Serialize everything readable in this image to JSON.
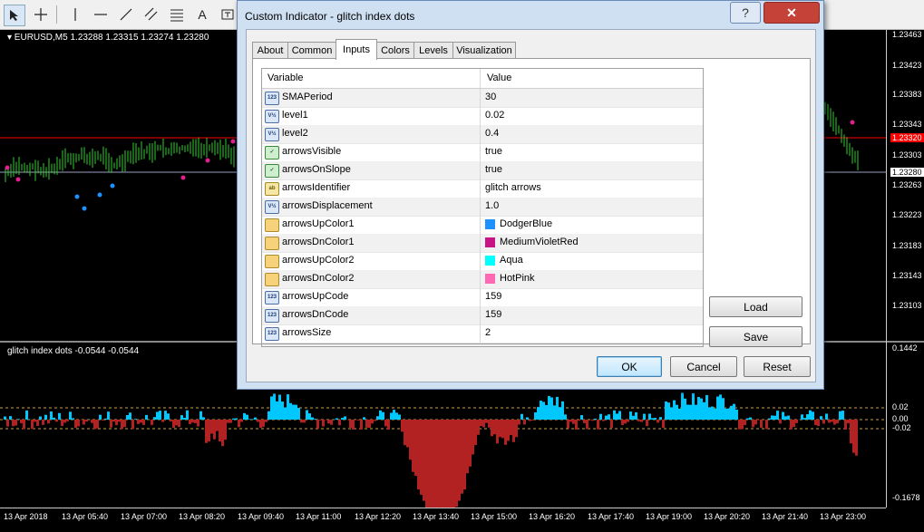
{
  "toolbar": {
    "icons": [
      "cursor-icon",
      "crosshair-icon",
      "vertical-line-icon",
      "horizontal-line-icon",
      "trendline-icon",
      "equidistant-channel-icon",
      "fibonacci-icon",
      "text-icon",
      "text-label-icon"
    ],
    "text_glyph": "A"
  },
  "chart": {
    "symbol_info": "▾ EURUSD,M5  1.23288 1.23315 1.23274 1.23280",
    "indicator_info": "glitch index dots -0.0544 -0.0544",
    "price_ticks": [
      "1.23463",
      "1.23423",
      "1.23383",
      "1.23343",
      "1.23303",
      "1.23263",
      "1.23223",
      "1.23183",
      "1.23143",
      "1.23103"
    ],
    "price_marker_red": "1.23320",
    "price_marker_white": "1.23280",
    "indicator_ticks": [
      "0.1442",
      "0.02",
      "0.00",
      "-0.02",
      "-0.1678"
    ],
    "time_ticks": [
      "13 Apr 2018",
      "13 Apr 05:40",
      "13 Apr 07:00",
      "13 Apr 08:20",
      "13 Apr 09:40",
      "13 Apr 11:00",
      "13 Apr 12:20",
      "13 Apr 13:40",
      "13 Apr 15:00",
      "13 Apr 16:20",
      "13 Apr 17:40",
      "13 Apr 19:00",
      "13 Apr 20:20",
      "13 Apr 21:40",
      "13 Apr 23:00"
    ]
  },
  "dialog": {
    "title": "Custom Indicator - glitch index dots",
    "help": "?",
    "close": "✕",
    "tabs": [
      "About",
      "Common",
      "Inputs",
      "Colors",
      "Levels",
      "Visualization"
    ],
    "active_tab": "Inputs",
    "columns": {
      "variable": "Variable",
      "value": "Value"
    },
    "params": [
      {
        "icon": "123",
        "name": "SMAPeriod",
        "value": "30"
      },
      {
        "icon": "V½",
        "name": "level1",
        "value": "0.02"
      },
      {
        "icon": "V½",
        "name": "level2",
        "value": "0.4"
      },
      {
        "icon": "bool",
        "name": "arrowsVisible",
        "value": "true"
      },
      {
        "icon": "bool",
        "name": "arrowsOnSlope",
        "value": "true"
      },
      {
        "icon": "ab",
        "name": "arrowsIdentifier",
        "value": "glitch arrows"
      },
      {
        "icon": "V½",
        "name": "arrowsDisplacement",
        "value": "1.0"
      },
      {
        "icon": "color",
        "name": "arrowsUpColor1",
        "value": "DodgerBlue",
        "color": "#1E90FF"
      },
      {
        "icon": "color",
        "name": "arrowsDnColor1",
        "value": "MediumVioletRed",
        "color": "#C71585"
      },
      {
        "icon": "color",
        "name": "arrowsUpColor2",
        "value": "Aqua",
        "color": "#00FFFF"
      },
      {
        "icon": "color",
        "name": "arrowsDnColor2",
        "value": "HotPink",
        "color": "#FF69B4"
      },
      {
        "icon": "123",
        "name": "arrowsUpCode",
        "value": "159"
      },
      {
        "icon": "123",
        "name": "arrowsDnCode",
        "value": "159"
      },
      {
        "icon": "123",
        "name": "arrowsSize",
        "value": "2"
      }
    ],
    "buttons": {
      "load": "Load",
      "save": "Save",
      "ok": "OK",
      "cancel": "Cancel",
      "reset": "Reset"
    }
  },
  "colors": {
    "candle": "#32cd32",
    "level_red": "#ff0000",
    "histo_up": "#00c8ff",
    "histo_dn": "#b22222",
    "dot_pink": "#e0208c",
    "dot_blue": "#1e90ff"
  }
}
